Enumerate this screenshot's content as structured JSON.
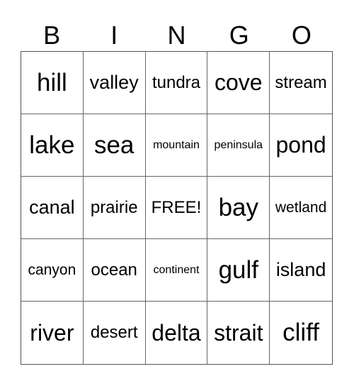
{
  "header": [
    "B",
    "I",
    "N",
    "G",
    "O"
  ],
  "cells": [
    {
      "text": "hill",
      "size": "s36"
    },
    {
      "text": "valley",
      "size": "s27"
    },
    {
      "text": "tundra",
      "size": "s24"
    },
    {
      "text": "cove",
      "size": "s32"
    },
    {
      "text": "stream",
      "size": "s24"
    },
    {
      "text": "lake",
      "size": "s36"
    },
    {
      "text": "sea",
      "size": "s36"
    },
    {
      "text": "mountain",
      "size": "s17"
    },
    {
      "text": "peninsula",
      "size": "s17"
    },
    {
      "text": "pond",
      "size": "s32"
    },
    {
      "text": "canal",
      "size": "s27"
    },
    {
      "text": "prairie",
      "size": "s24"
    },
    {
      "text": "FREE!",
      "size": "s24"
    },
    {
      "text": "bay",
      "size": "s36"
    },
    {
      "text": "wetland",
      "size": "s21"
    },
    {
      "text": "canyon",
      "size": "s21"
    },
    {
      "text": "ocean",
      "size": "s24"
    },
    {
      "text": "continent",
      "size": "s17"
    },
    {
      "text": "gulf",
      "size": "s36"
    },
    {
      "text": "island",
      "size": "s27"
    },
    {
      "text": "river",
      "size": "s32"
    },
    {
      "text": "desert",
      "size": "s24"
    },
    {
      "text": "delta",
      "size": "s32"
    },
    {
      "text": "strait",
      "size": "s32"
    },
    {
      "text": "cliff",
      "size": "s36"
    }
  ]
}
